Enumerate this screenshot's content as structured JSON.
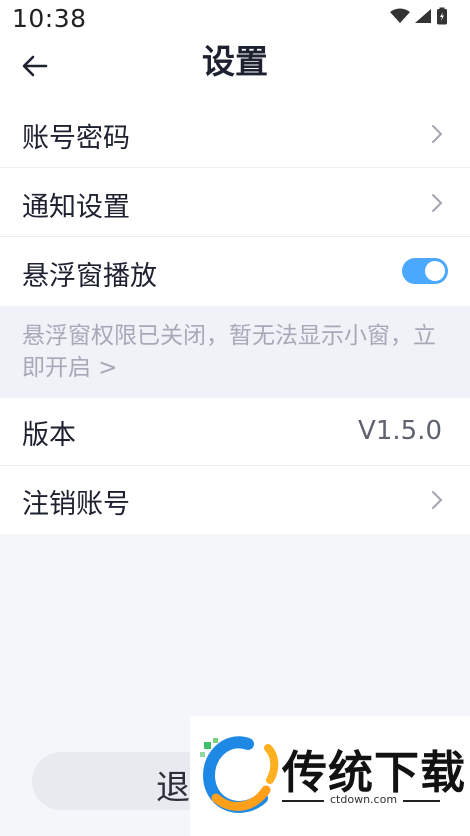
{
  "status_bar": {
    "time": "10:38"
  },
  "header": {
    "title": "设置"
  },
  "settings": {
    "account_password": "账号密码",
    "notification_settings": "通知设置",
    "floating_window_playback": "悬浮窗播放",
    "floating_notice": "悬浮窗权限已关闭，暂无法显示小窗，立即开启 >",
    "version_label": "版本",
    "version_value": "V1.5.0",
    "cancel_account": "注销账号"
  },
  "logout": {
    "label": "退"
  },
  "watermark": {
    "brand": "传统下载",
    "domain": "ctdown.com"
  },
  "colors": {
    "accent": "#4aa8ff",
    "page_bg": "#f5f6fa",
    "notice_text": "#a6a9b8"
  }
}
